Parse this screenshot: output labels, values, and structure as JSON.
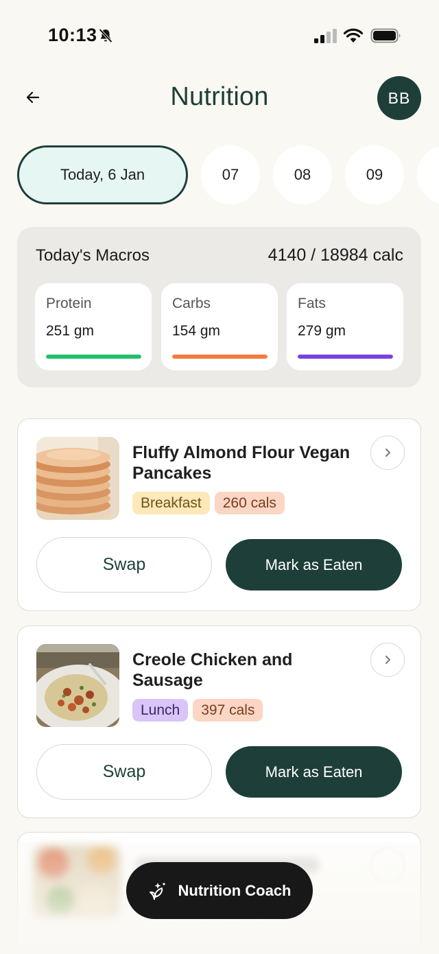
{
  "status_bar": {
    "time": "10:13",
    "icons": [
      "bell-slash-icon",
      "cellular-signal-icon",
      "wifi-icon",
      "battery-icon"
    ]
  },
  "header": {
    "title": "Nutrition",
    "back_icon": "arrow-left-icon",
    "avatar_initials": "BB"
  },
  "dates": {
    "selected": "Today, 6 Jan",
    "days": [
      "07",
      "08",
      "09"
    ]
  },
  "macros": {
    "title": "Today's Macros",
    "total": "4140 / 18984 calc",
    "items": [
      {
        "label": "Protein",
        "value": "251 gm",
        "color": "#22c06a",
        "fill": 1.0
      },
      {
        "label": "Carbs",
        "value": "154 gm",
        "color": "#f47b3f",
        "fill": 1.0
      },
      {
        "label": "Fats",
        "value": "279 gm",
        "color": "#7a42e0",
        "fill": 1.0
      }
    ]
  },
  "meals": [
    {
      "title": "Fluffy Almond Flour Vegan Pancakes",
      "meal_type": "Breakfast",
      "meal_type_color": "#fce8b8",
      "meal_type_text": "#6b5416",
      "calories": "260 cals",
      "swap_label": "Swap",
      "eaten_label": "Mark as Eaten"
    },
    {
      "title": "Creole Chicken and Sausage",
      "meal_type": "Lunch",
      "meal_type_color": "#d9c5f7",
      "meal_type_text": "#3e2766",
      "calories": "397 cals",
      "swap_label": "Swap",
      "eaten_label": "Mark as Eaten"
    }
  ],
  "calorie_tag": {
    "bg": "#fbd6c4",
    "text": "#7a3c20"
  },
  "coach": {
    "label": "Nutrition Coach",
    "icon": "sparkle-leaf-icon"
  },
  "colors": {
    "brand": "#1e3f39",
    "background": "#faf8f3"
  }
}
